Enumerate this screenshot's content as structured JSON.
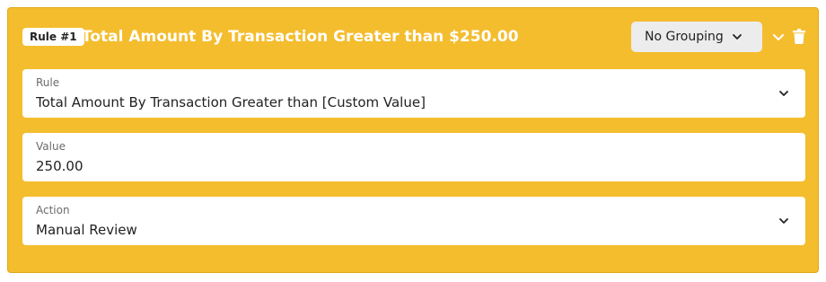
{
  "rule": {
    "badge": "Rule #1",
    "title": "Total Amount By Transaction Greater than $250.00"
  },
  "grouping": {
    "selected": "No Grouping"
  },
  "fields": {
    "rule": {
      "label": "Rule",
      "value": "Total Amount By Transaction Greater than [Custom Value]"
    },
    "value": {
      "label": "Value",
      "value": "250.00"
    },
    "action": {
      "label": "Action",
      "value": "Manual Review"
    }
  },
  "colors": {
    "card_background": "#f4bd2e",
    "header_text": "#ffffff",
    "field_background": "#ffffff",
    "grouping_background": "#ececec"
  },
  "icons": {
    "grouping": "chevron-down-icon",
    "collapse": "chevron-down-icon",
    "delete": "trash-icon",
    "field_dropdown": "chevron-down-icon"
  }
}
